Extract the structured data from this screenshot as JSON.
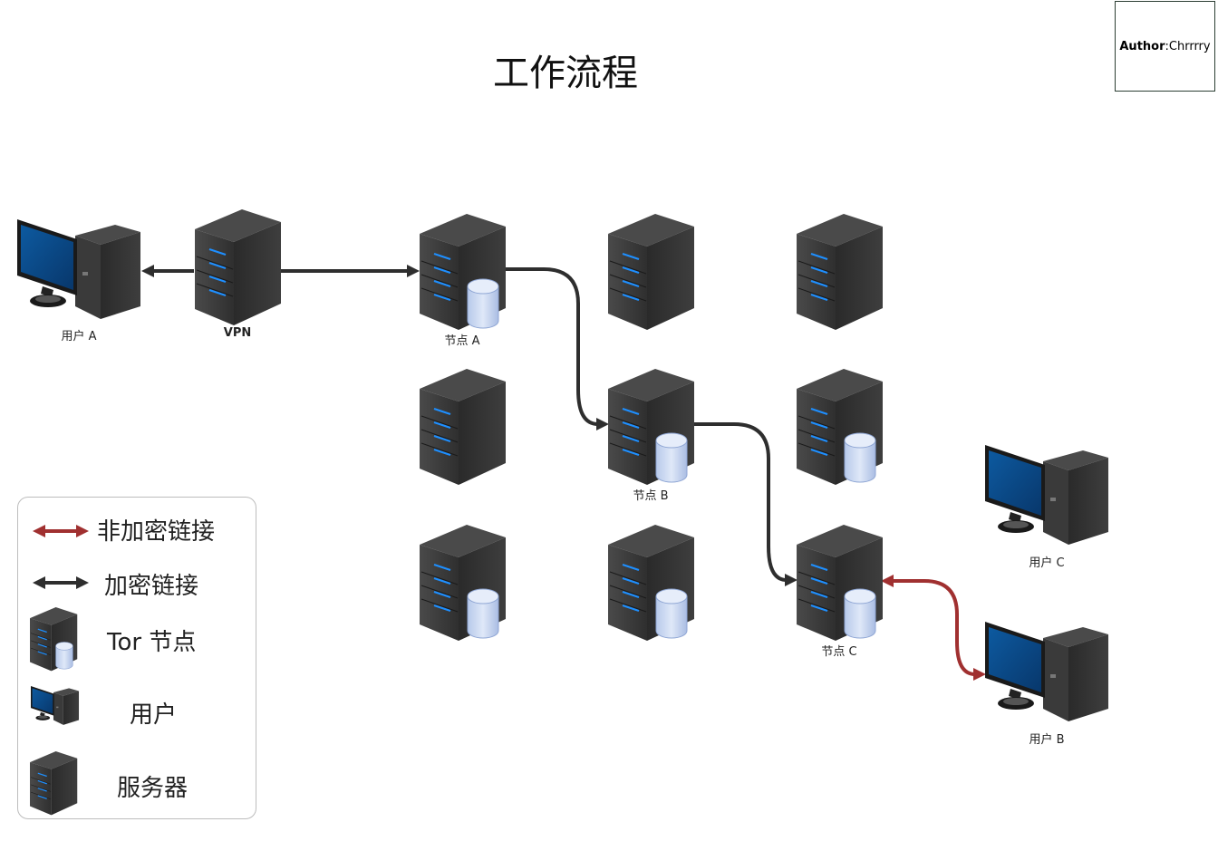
{
  "title": "工作流程",
  "author": {
    "key": "Author",
    "value": ":Chrrrry"
  },
  "nodes": {
    "user_a": "用户 A",
    "vpn": "VPN",
    "node_a": "节点  A",
    "node_b": "节点 B",
    "node_c": "节点 C",
    "user_c": "用户 C",
    "user_b": "用户 B"
  },
  "legend": {
    "unencrypted": "非加密链接",
    "encrypted": "加密链接",
    "tor_node": "Tor 节点",
    "user": "用户",
    "server": "服务器"
  },
  "colors": {
    "encrypted_link": "#2e2e2e",
    "unencrypted_link": "#a03030",
    "server_body": "#333333",
    "server_led": "#1e90ff",
    "monitor_screen": "#0b4f8f",
    "db_cylinder": "#c9d9f2"
  },
  "icons": [
    "server-icon",
    "database-icon",
    "user-computer-icon",
    "double-arrow-icon"
  ]
}
